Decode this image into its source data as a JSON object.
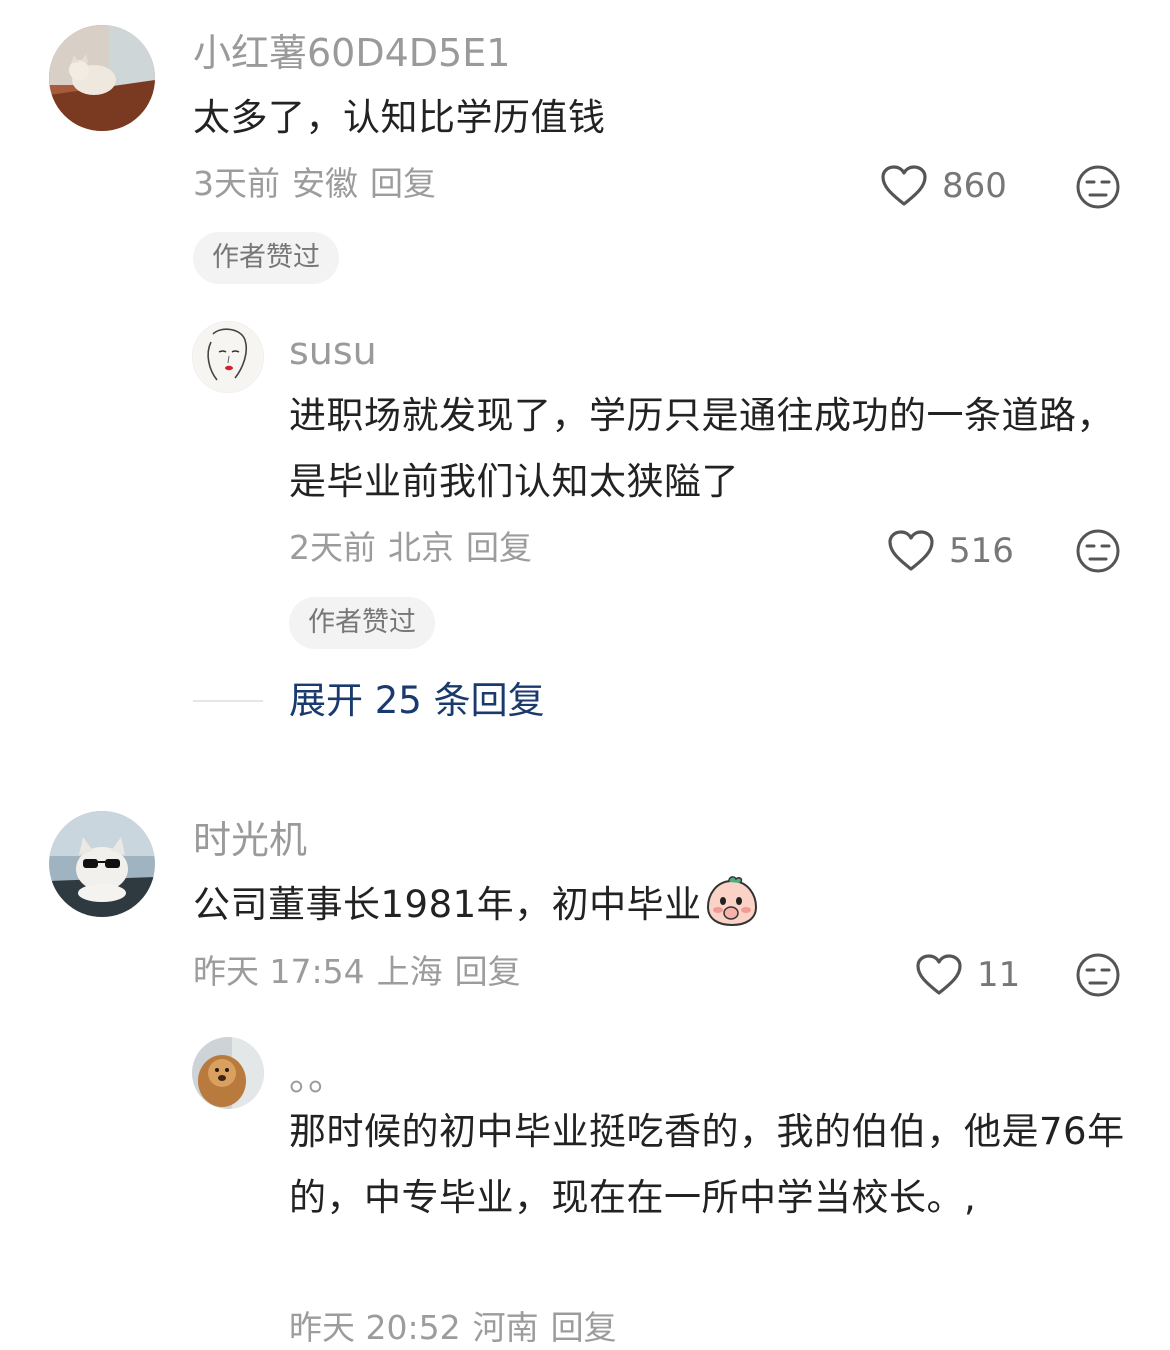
{
  "comments": [
    {
      "username": "小红薯60D4D5E1",
      "text": "太多了，认知比学历值钱",
      "time": "3天前",
      "location": "安徽",
      "reply_label": "回复",
      "likes": "860",
      "tag": "作者赞过",
      "reply": {
        "username": "susu",
        "text": "进职场就发现了，学历只是通往成功的一条道路，是毕业前我们认知太狭隘了",
        "time": "2天前",
        "location": "北京",
        "reply_label": "回复",
        "likes": "516",
        "tag": "作者赞过"
      },
      "expand_label": "展开 25 条回复"
    },
    {
      "username": "时光机",
      "text": "公司董事长1981年，初中毕业",
      "time": "昨天 17:54",
      "location": "上海",
      "reply_label": "回复",
      "likes": "11",
      "reply": {
        "username": "。。",
        "text": "那时候的初中毕业挺吃香的，我的伯伯，他是76年的，中专毕业，现在在一所中学当校长。,",
        "time": "昨天 20:52",
        "location": "河南",
        "reply_label": "回复"
      }
    }
  ],
  "colors": {
    "username": "#9a9a9a",
    "content": "#222222",
    "meta": "#9c9c9c",
    "expand_link": "#1a3a6e",
    "tag_bg": "#f3f3f3"
  },
  "icons": [
    "heart-icon",
    "dislike-face-icon",
    "blush-emoji-icon"
  ]
}
